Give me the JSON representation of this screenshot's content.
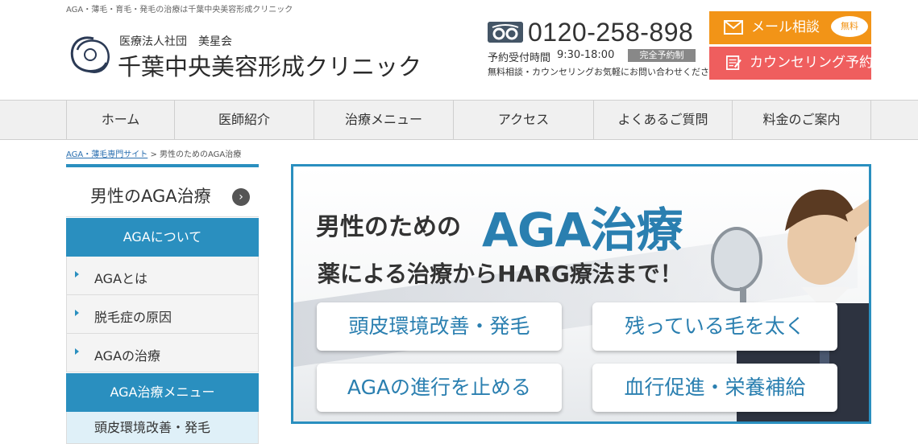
{
  "tagline": "AGA・薄毛・育毛・発毛の治療は千葉中央美容形成クリニック",
  "logo": {
    "sub": "医療法人社団　美星会",
    "name": "千葉中央美容形成クリニック"
  },
  "phone": {
    "number": "0120-258-898",
    "hours_label": "予約受付時間",
    "hours": "9:30-18:00",
    "badge": "完全予約制",
    "note": "無料相談・カウンセリングお気軽にお問い合わせください"
  },
  "cta": {
    "mail": "メール相談",
    "free": "無料",
    "counsel": "カウンセリング予約"
  },
  "nav": [
    "ホーム",
    "医師紹介",
    "治療メニュー",
    "アクセス",
    "よくあるご質問",
    "料金のご案内"
  ],
  "breadcrumb": {
    "link": "AGA・薄毛専門サイト",
    "sep": " > ",
    "current": "男性のためのAGA治療"
  },
  "sidebar": {
    "title": "男性のAGA治療",
    "cat1": "AGAについて",
    "items": [
      "AGAとは",
      "脱毛症の原因",
      "AGAの治療"
    ],
    "cat2": "AGA治療メニュー",
    "sub1": "頭皮環境改善・発毛"
  },
  "hero": {
    "t1a": "男性のための",
    "t1b": "AGA治療",
    "t2": "薬による治療からHARG療法まで！",
    "boxes": [
      "頭皮環境改善・発毛",
      "残っている毛を太く",
      "AGAの進行を止める",
      "血行促進・栄養補給"
    ]
  },
  "colors": {
    "accent": "#2a8fbf",
    "mail": "#f29417",
    "counsel": "#ef5e5e"
  }
}
